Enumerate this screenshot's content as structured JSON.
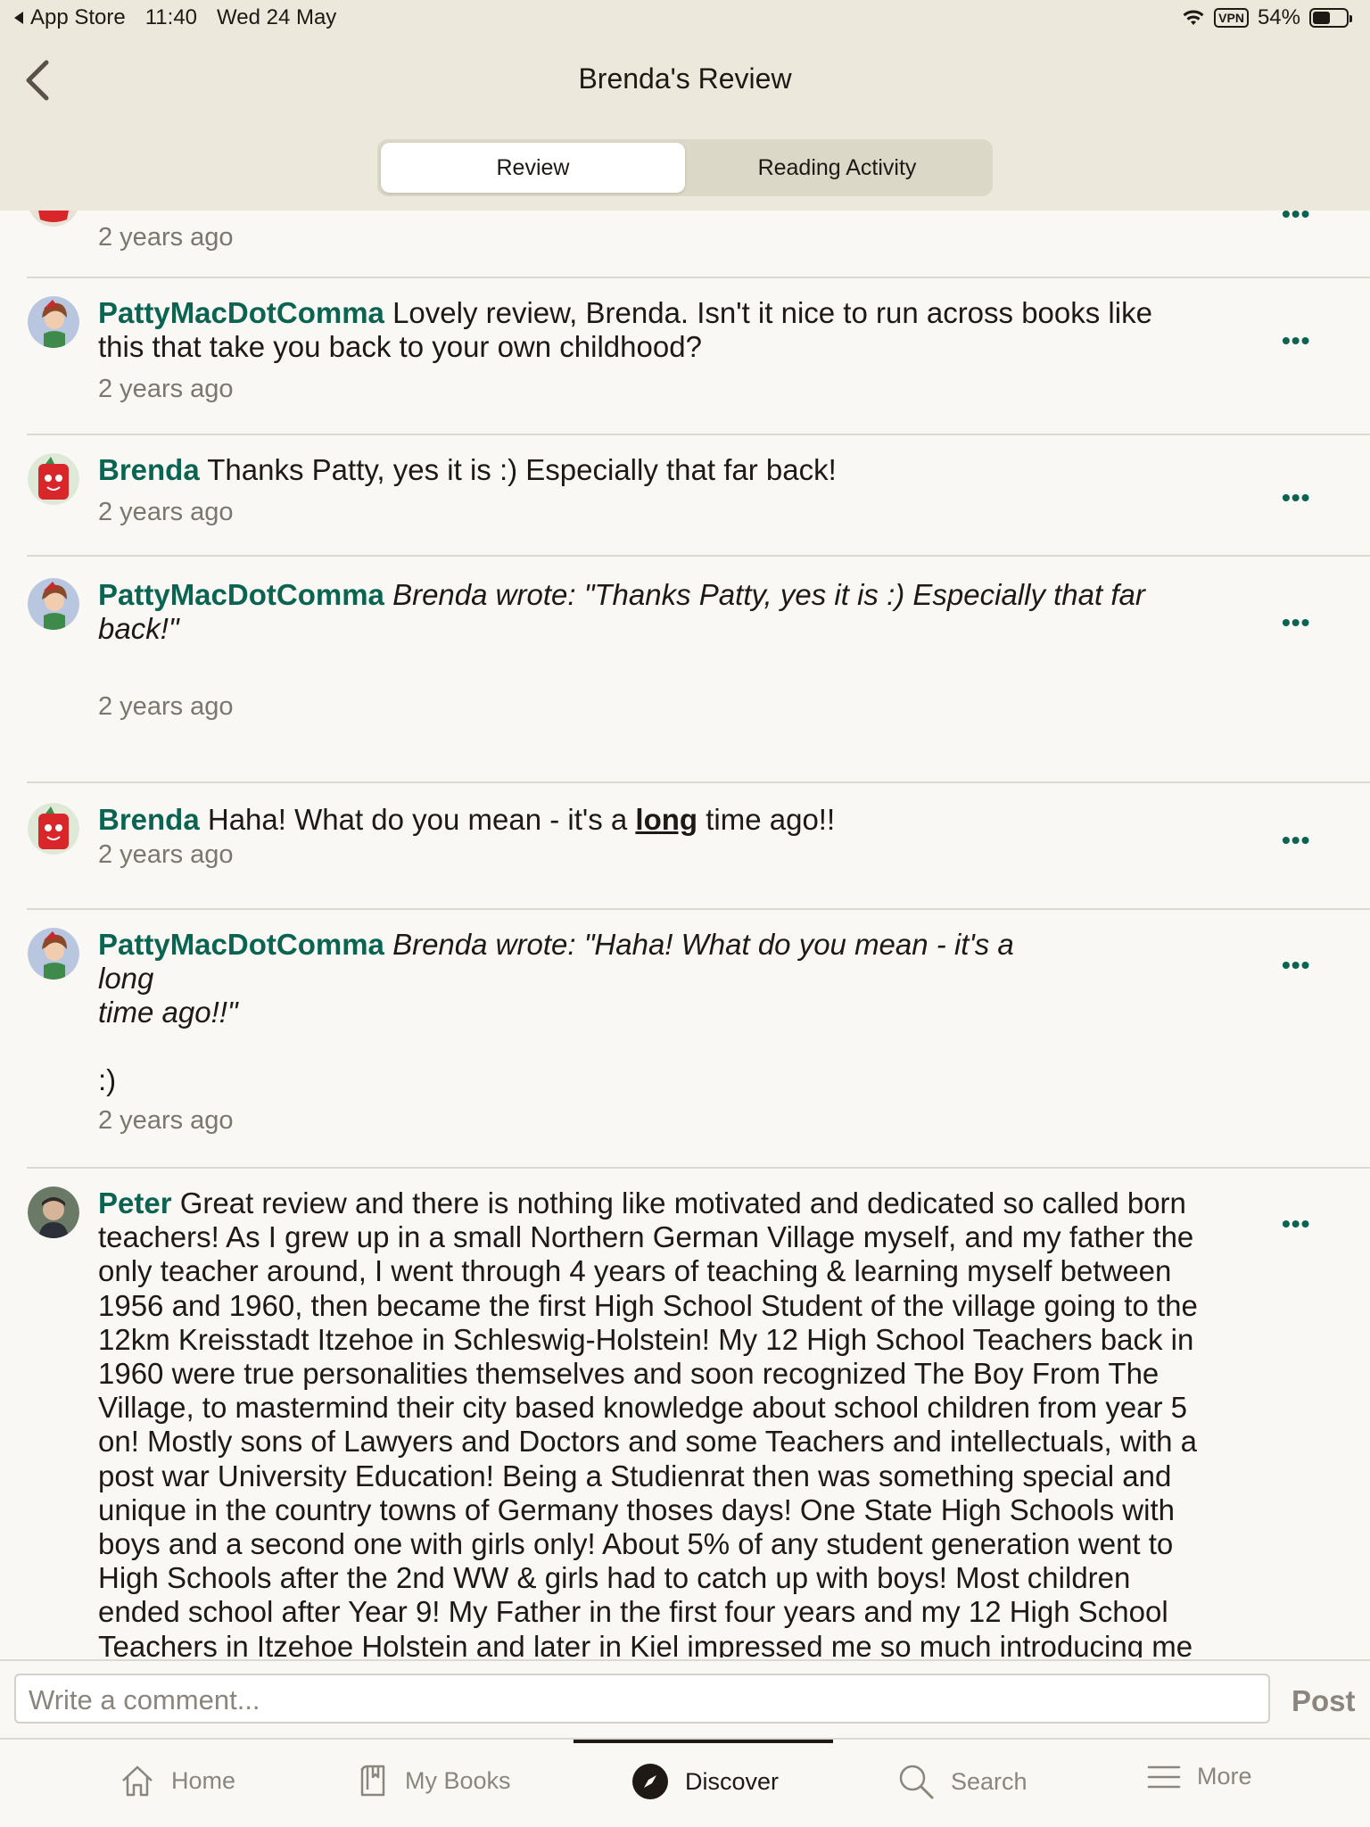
{
  "status_bar": {
    "back_app": "App Store",
    "time": "11:40",
    "date": "Wed 24 May",
    "vpn": "VPN",
    "battery": "54%",
    "battery_level": 0.54
  },
  "nav": {
    "title": "Brenda's Review"
  },
  "segments": [
    {
      "label": "Review",
      "active": true
    },
    {
      "label": "Reading Activity",
      "active": false
    }
  ],
  "comments": [
    {
      "author": "",
      "time": "2 years ago"
    },
    {
      "author": "PattyMacDotComma",
      "text_line1": " Lovely review, Brenda. Isn't it nice to run across books like",
      "text_line2": "this that take you back to your own childhood?",
      "time": "2 years ago"
    },
    {
      "author": "Brenda",
      "text": " Thanks Patty, yes it is :) Especially that far back!",
      "time": "2 years ago"
    },
    {
      "author": "PattyMacDotComma",
      "quote_line1": " Brenda wrote: \"Thanks Patty, yes it is :) Especially that far",
      "quote_line2": "back!\"",
      "time": "2 years ago"
    },
    {
      "author": "Brenda",
      "text_before": " Haha! What do you mean - it's a ",
      "emphasis": "long",
      "text_after": " time ago!!",
      "time": "2 years ago"
    },
    {
      "author": "PattyMacDotComma",
      "quote_line1": " Brenda wrote: \"Haha! What do you mean - it's a",
      "quote_line2": "long",
      "quote_line3": "time ago!!\"",
      "text_extra": ":)",
      "time": "2 years ago"
    },
    {
      "author": "Peter",
      "lines": [
        " Great review and there is nothing like motivated and dedicated so called born",
        "teachers! As I grew up in a small Northern German Village myself, and my father the",
        "only teacher around, I went through 4 years of teaching & learning myself between",
        "1956 and 1960, then became the first High School Student of the village going to the",
        "12km Kreisstadt Itzehoe in Schleswig-Holstein! My 12 High School Teachers back in",
        "1960 were true personalities themselves and soon recognized The Boy From The",
        "Village, to mastermind their city based knowledge about school children from year 5",
        "on! Mostly sons of Lawyers and Doctors and some Teachers and intellectuals, with a",
        "post war University Education! Being a Studienrat then was something special and",
        "unique in the country towns of Germany thoses days! One State High Schools with",
        "boys and a second one with girls only! About 5% of any student generation went to",
        "High Schools after the 2nd WW & girls had to catch up with boys! Most children",
        "ended school after Year 9! My Father in the first four years and my 12 High School",
        "Teachers in Itzehoe Holstein and later in Kiel impressed me so much introducing me"
      ]
    }
  ],
  "composer": {
    "placeholder": "Write a comment...",
    "post_label": "Post"
  },
  "tabs": [
    {
      "label": "Home",
      "icon": "home-icon",
      "active": false
    },
    {
      "label": "My Books",
      "icon": "book-icon",
      "active": false
    },
    {
      "label": "Discover",
      "icon": "compass-icon",
      "active": true
    },
    {
      "label": "Search",
      "icon": "search-icon",
      "active": false
    },
    {
      "label": "More",
      "icon": "menu-icon",
      "active": false
    }
  ],
  "colors": {
    "accent": "#0b6451",
    "header_bg": "#ece9dc",
    "page_bg": "#f9f8f4"
  }
}
